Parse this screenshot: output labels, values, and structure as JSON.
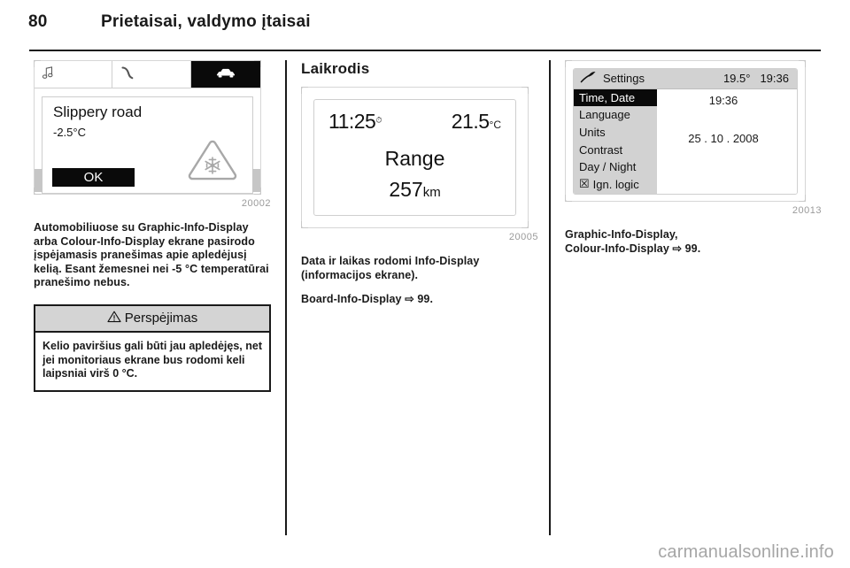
{
  "header": {
    "page_number": "80",
    "title": "Prietaisai, valdymo įtaisai"
  },
  "column1": {
    "figure": {
      "caption": "20002",
      "display": {
        "tabs": [
          {
            "icon": "music-note-icon",
            "glyph": "♫",
            "selected": false
          },
          {
            "icon": "phone-handset-icon",
            "glyph": "✆",
            "selected": false
          },
          {
            "icon": "car-icon",
            "glyph": "Ὡ7",
            "selected": true
          }
        ],
        "message_title": "Slippery road",
        "message_temp": "-2.5°C",
        "ok_label": "OK",
        "warning_icon": "snowflake-warning-triangle-icon"
      }
    },
    "paragraph": "Automobiliuose su Graphic-Info-Display arba Colour-Info-Display ekrane pasirodo įspėjamasis pranešimas apie apledėjusį kelią. Esant žemesnei nei -5 °C temperatūrai pranešimo nebus.",
    "warning": {
      "icon": "warning-triangle-icon",
      "title": "Perspėjimas",
      "body": "Kelio paviršius gali būti jau apledėjęs, net jei monitoriaus ekrane bus rodomi keli laipsniai virš 0 °C."
    }
  },
  "column2": {
    "heading": "Laikrodis",
    "figure": {
      "caption": "20005",
      "display": {
        "time": "11:25",
        "rds_icon": "rds-clock-icon",
        "temperature": "21.5",
        "temperature_unit": "°C",
        "range_label": "Range",
        "range_value": "257",
        "range_unit": "km"
      }
    },
    "paragraph1": "Data ir laikas rodomi Info-Display (informacijos ekrane).",
    "paragraph2_text": "Board-Info-Display",
    "paragraph2_arrow": "⇨",
    "paragraph2_page": "99."
  },
  "column3": {
    "figure": {
      "caption": "20013",
      "display": {
        "header_icon": "settings-wrench-icon",
        "header_title": "Settings",
        "header_temp": "19.5°",
        "header_time": "19:36",
        "menu": [
          {
            "label": "Time, Date",
            "selected": true,
            "checkbox": false
          },
          {
            "label": "Language",
            "selected": false,
            "checkbox": false
          },
          {
            "label": "Units",
            "selected": false,
            "checkbox": false
          },
          {
            "label": "Contrast",
            "selected": false,
            "checkbox": false
          },
          {
            "label": "Day / Night",
            "selected": false,
            "checkbox": false
          },
          {
            "label": "Ign. logic",
            "selected": false,
            "checkbox": true,
            "checkbox_glyph": "☒"
          }
        ],
        "value_time": "19:36",
        "value_date": "25 . 10 . 2008"
      }
    },
    "paragraph_line1": "Graphic-Info-Display,",
    "paragraph_line2_text": "Colour-Info-Display",
    "paragraph_line2_arrow": "⇨",
    "paragraph_line2_page": "99."
  },
  "watermark": "carmanualsonline.info"
}
